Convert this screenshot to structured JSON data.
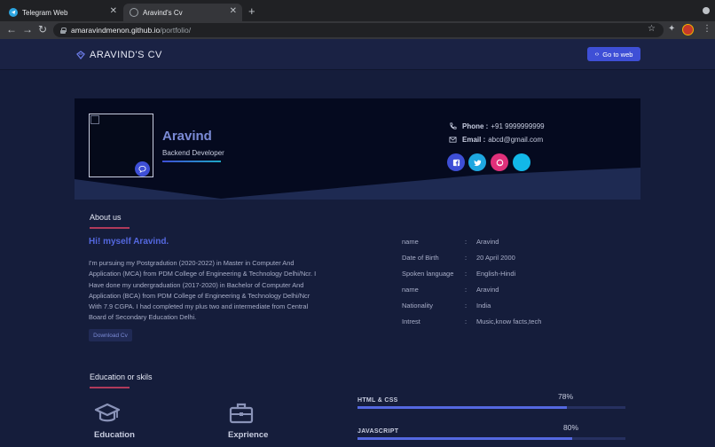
{
  "browser": {
    "tabs": [
      {
        "label": "Telegram Web",
        "active": false
      },
      {
        "label": "Aravind's Cv",
        "active": true
      }
    ],
    "url_host": "amaravindmenon.github.io",
    "url_path": "/portfolio/"
  },
  "site": {
    "brand": "ARAVIND'S CV",
    "goto_label": "Go to web"
  },
  "profile": {
    "name": "Aravind",
    "role": "Backend Developer",
    "phone_label": "Phone :",
    "phone": "+91 9999999999",
    "email_label": "Email :",
    "email": "abcd@gmail.com",
    "social": [
      {
        "icon": "facebook-icon",
        "color": "#3e4fd6"
      },
      {
        "icon": "twitter-icon",
        "color": "#1ea7e0"
      },
      {
        "icon": "github-icon",
        "color": "#e0307a"
      },
      {
        "icon": "link-icon",
        "color": "#12b8e8"
      }
    ]
  },
  "about": {
    "title": "About us",
    "greeting": "Hi! myself Aravind.",
    "text": "I'm pursuing my Postgradution (2020-2022) in Master in Computer And Application (MCA) from PDM College of Engineering & Technology Delhi/Ncr. I Have done my undergraduation (2017-2020) in Bachelor of Computer And Application (BCA) from PDM College of Engineering & Technology Delhi/Ncr With 7.9 CGPA. I had completed my plus two and intermediate from Central Board of Secondary Education Delhi.",
    "download_label": "Download Cv",
    "details": [
      {
        "key": "name",
        "value": "Aravind"
      },
      {
        "key": "Date of Birth",
        "value": "20 April 2000"
      },
      {
        "key": "Spoken language",
        "value": "English-Hindi"
      },
      {
        "key": "name",
        "value": "Aravind"
      },
      {
        "key": "Nationality",
        "value": "India"
      },
      {
        "key": "Intrest",
        "value": "Music,know facts,tech"
      }
    ]
  },
  "education": {
    "title": "Education or skils",
    "cards": [
      {
        "label": "Education",
        "icon": "graduation-cap-icon"
      },
      {
        "label": "Exprience",
        "icon": "briefcase-icon"
      }
    ],
    "skills": [
      {
        "name": "HTML & CSS",
        "percent_label": "78%",
        "percent": 78
      },
      {
        "name": "JAVASCRIPT",
        "percent_label": "80%",
        "percent": 80
      }
    ]
  },
  "colors": {
    "accent": "#3e4fd6",
    "page_bg": "#151d3b",
    "hero_bg": "#050a1f",
    "underline": "#b03a5b"
  }
}
